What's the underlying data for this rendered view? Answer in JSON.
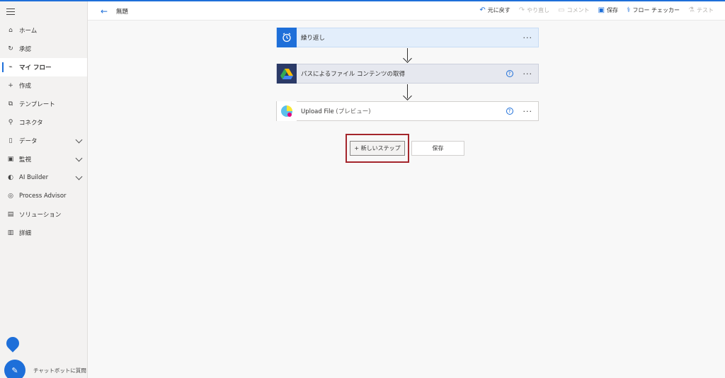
{
  "header": {
    "title": "無題",
    "actions": [
      {
        "label": "元に戻す",
        "icon": "undo-icon",
        "enabled": true
      },
      {
        "label": "やり直し",
        "icon": "redo-icon",
        "enabled": false
      },
      {
        "label": "コメント",
        "icon": "comment-icon",
        "enabled": false
      },
      {
        "label": "保存",
        "icon": "save-icon",
        "enabled": true
      },
      {
        "label": "フロー チェッカー",
        "icon": "stethoscope-icon",
        "enabled": true
      },
      {
        "label": "テスト",
        "icon": "flask-icon",
        "enabled": false
      }
    ]
  },
  "sidebar": {
    "items": [
      {
        "label": "ホーム",
        "icon": "home-icon"
      },
      {
        "label": "承認",
        "icon": "approval-icon"
      },
      {
        "label": "マイ フロー",
        "icon": "flow-icon",
        "active": true
      },
      {
        "label": "作成",
        "icon": "plus-icon"
      },
      {
        "label": "テンプレート",
        "icon": "template-icon"
      },
      {
        "label": "コネクタ",
        "icon": "connector-icon"
      },
      {
        "label": "データ",
        "icon": "database-icon",
        "expandable": true
      },
      {
        "label": "監視",
        "icon": "monitor-icon",
        "expandable": true
      },
      {
        "label": "AI Builder",
        "icon": "ai-builder-icon",
        "expandable": true
      },
      {
        "label": "Process Advisor",
        "icon": "process-advisor-icon"
      },
      {
        "label": "ソリューション",
        "icon": "solution-icon"
      },
      {
        "label": "詳細",
        "icon": "book-icon"
      }
    ],
    "chatbot_label": "チャットボットに質問"
  },
  "flow": {
    "steps": [
      {
        "title": "繰り返し",
        "icon": "alarm-clock-icon",
        "icon_bg": "#1e6fd9"
      },
      {
        "title": "パスによるファイル コンテンツの取得",
        "icon": "google-drive-icon",
        "icon_bg": "#2b3a67"
      },
      {
        "title": "Upload File",
        "suffix": "(プレビュー)",
        "icon": "upload-service-icon",
        "icon_bg": "#ffffff"
      }
    ],
    "new_step_label": "+ 新しいステップ",
    "save_label": "保存"
  },
  "colors": {
    "accent": "#1e6fd9",
    "highlight_border": "#a4262c"
  }
}
